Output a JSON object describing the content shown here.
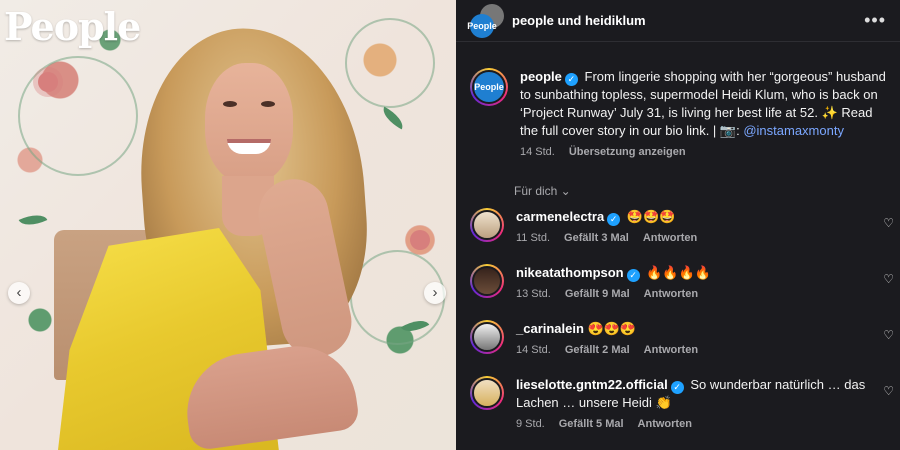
{
  "left_photo": {
    "brand": "People"
  },
  "header": {
    "title": "people und heidiklum",
    "avatar_text": "People"
  },
  "caption": {
    "user": "people",
    "text": "From lingerie shopping with her “gorgeous” husband to sunbathing topless, supermodel Heidi Klum, who is back on ‘Project Runway’ July 31, is living her best life at 52. ✨ Read the full cover story in our bio link. | 📷: ",
    "mention": "@instamaxmonty",
    "time": "14 Std.",
    "translate": "Übersetzung anzeigen"
  },
  "for_you": "Für dich ⌄",
  "comments": [
    {
      "user": "carmenelectra",
      "text": "🤩🤩🤩",
      "time": "11 Std.",
      "likes": "Gefällt 3 Mal",
      "reply": "Antworten"
    },
    {
      "user": "nikeatathompson",
      "text": "🔥🔥🔥🔥",
      "time": "13 Std.",
      "likes": "Gefällt 9 Mal",
      "reply": "Antworten"
    },
    {
      "user": "_carinalein",
      "text": "😍😍😍",
      "time": "14 Std.",
      "likes": "Gefällt 2 Mal",
      "reply": "Antworten"
    },
    {
      "user": "lieselotte.gntm22.official",
      "text": "So wunderbar natürlich … das Lachen … unsere Heidi 👏",
      "time": "9 Std.",
      "likes": "Gefällt 5 Mal",
      "reply": "Antworten"
    }
  ],
  "icons": {
    "more": "more-icon",
    "heart": "heart-icon",
    "prev": "chevron-left-icon",
    "next": "chevron-right-icon",
    "verified": "verified-badge-icon"
  },
  "colors": {
    "panel_bg": "#1b1b1f",
    "verified": "#1ea1ff",
    "mention": "#7ba7ff",
    "dress": "#f7e04a"
  }
}
